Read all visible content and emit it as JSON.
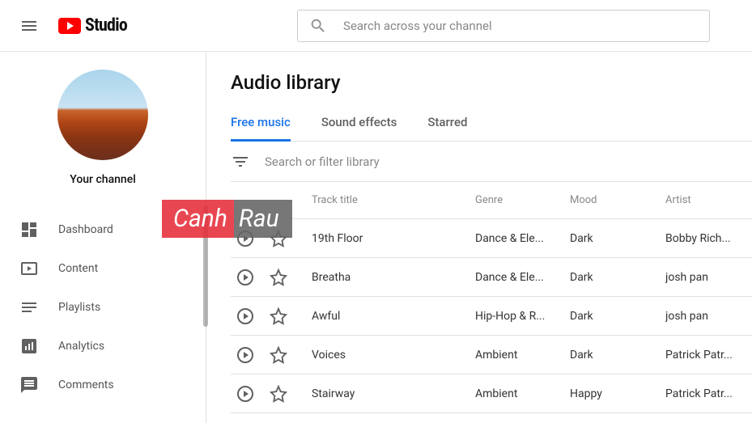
{
  "header": {
    "brand": "Studio",
    "search_placeholder": "Search across your channel"
  },
  "sidebar": {
    "channel_label": "Your channel",
    "items": [
      {
        "label": "Dashboard"
      },
      {
        "label": "Content"
      },
      {
        "label": "Playlists"
      },
      {
        "label": "Analytics"
      },
      {
        "label": "Comments"
      }
    ]
  },
  "main": {
    "title": "Audio library",
    "tabs": [
      {
        "label": "Free music",
        "active": true
      },
      {
        "label": "Sound effects",
        "active": false
      },
      {
        "label": "Starred",
        "active": false
      }
    ],
    "filter_placeholder": "Search or filter library",
    "columns": {
      "title": "Track title",
      "genre": "Genre",
      "mood": "Mood",
      "artist": "Artist"
    },
    "tracks": [
      {
        "title": "19th Floor",
        "genre": "Dance & Ele...",
        "mood": "Dark",
        "artist": "Bobby Rich..."
      },
      {
        "title": "Breatha",
        "genre": "Dance & Ele...",
        "mood": "Dark",
        "artist": "josh pan"
      },
      {
        "title": "Awful",
        "genre": "Hip-Hop & R...",
        "mood": "Dark",
        "artist": "josh pan"
      },
      {
        "title": "Voices",
        "genre": "Ambient",
        "mood": "Dark",
        "artist": "Patrick Patr..."
      },
      {
        "title": "Stairway",
        "genre": "Ambient",
        "mood": "Happy",
        "artist": "Patrick Patr..."
      }
    ]
  },
  "watermark": {
    "part1": "Canh",
    "part2": "Rau"
  }
}
